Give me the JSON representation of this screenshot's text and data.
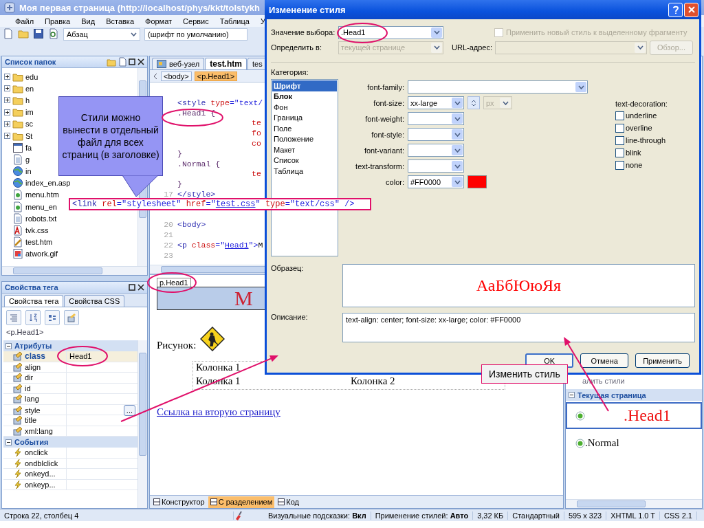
{
  "window": {
    "title": "Моя первая страница (http://localhost/phys/kkt/tolstykh"
  },
  "menu": [
    "Файл",
    "Правка",
    "Вид",
    "Вставка",
    "Формат",
    "Сервис",
    "Таблица",
    "У"
  ],
  "toolbar": {
    "block_format": "Абзац",
    "font": "(шрифт по умолчанию)"
  },
  "folders": {
    "title": "Список папок",
    "items": [
      {
        "name": "edu",
        "kind": "folder"
      },
      {
        "name": "en",
        "kind": "folder"
      },
      {
        "name": "h",
        "kind": "folder"
      },
      {
        "name": "im",
        "kind": "folder"
      },
      {
        "name": "sc",
        "kind": "folder"
      },
      {
        "name": "St",
        "kind": "folder"
      },
      {
        "name": "fa",
        "kind": "window"
      },
      {
        "name": "g",
        "kind": "page"
      },
      {
        "name": "in",
        "kind": "web"
      },
      {
        "name": "index_en.asp",
        "kind": "web"
      },
      {
        "name": "menu.htm",
        "kind": "html"
      },
      {
        "name": "menu_en",
        "kind": "html"
      },
      {
        "name": "robots.txt",
        "kind": "page"
      },
      {
        "name": "tvk.css",
        "kind": "css"
      },
      {
        "name": "test.htm",
        "kind": "edit"
      },
      {
        "name": "atwork.gif",
        "kind": "image"
      }
    ]
  },
  "tag_properties": {
    "title": "Свойства тега",
    "tabs": [
      {
        "label": "Свойства тега",
        "selected": true
      },
      {
        "label": "Свойства CSS",
        "selected": false
      }
    ],
    "path": "<p.Head1>",
    "groups": [
      {
        "title": "Атрибуты",
        "kind": "attribute",
        "rows": [
          {
            "name": "class",
            "value": "Head1",
            "selected": true
          },
          {
            "name": "align",
            "selected": false
          },
          {
            "name": "dir",
            "selected": false
          },
          {
            "name": "id",
            "selected": false
          },
          {
            "name": "lang",
            "selected": false
          },
          {
            "name": "style",
            "selected": false,
            "button": "..."
          },
          {
            "name": "title",
            "selected": false
          },
          {
            "name": "xml:lang",
            "selected": false
          }
        ]
      },
      {
        "title": "События",
        "kind": "event",
        "rows": [
          {
            "name": "onclick",
            "selected": false
          },
          {
            "name": "ondblclick",
            "selected": false
          },
          {
            "name": "onkeyd...",
            "selected": false
          },
          {
            "name": "onkeyp...",
            "selected": false
          }
        ]
      }
    ]
  },
  "editor": {
    "tabs": [
      {
        "label": "веб-узел",
        "selected": false
      },
      {
        "label": "test.htm",
        "selected": true
      },
      {
        "label": "tes",
        "selected": false
      }
    ],
    "breadcrumbs": [
      {
        "label": "<body>",
        "selected": false
      },
      {
        "label": "<p.Head1>",
        "selected": true
      }
    ],
    "code": [
      {
        "tokens": [
          {
            "text": "<style ",
            "kind": "tag"
          },
          {
            "text": "type",
            "kind": "attr"
          },
          {
            "text": "=\"text/",
            "kind": "value"
          }
        ]
      },
      {
        "tokens": [
          {
            "text": ".Head1 {",
            "kind": "selector"
          }
        ]
      },
      {
        "indent": true,
        "tokens": [
          {
            "text": "te",
            "kind": "prop"
          }
        ]
      },
      {
        "indent": true,
        "tokens": [
          {
            "text": "fo",
            "kind": "prop"
          }
        ]
      },
      {
        "indent": true,
        "tokens": [
          {
            "text": "co",
            "kind": "prop"
          }
        ]
      },
      {
        "tokens": [
          {
            "text": "}",
            "kind": "selector"
          }
        ]
      },
      {
        "tokens": [
          {
            "text": ".Normal {",
            "kind": "selector"
          }
        ]
      },
      {
        "indent": true,
        "tokens": [
          {
            "text": "te",
            "kind": "prop"
          }
        ]
      },
      {
        "tokens": [
          {
            "text": "}",
            "kind": "selector"
          }
        ]
      },
      {
        "number": "17",
        "tokens": [
          {
            "text": "</style>",
            "kind": "tag"
          }
        ]
      },
      {
        "number": "20",
        "tokens": [
          {
            "text": "<body>",
            "kind": "tag"
          }
        ]
      },
      {
        "number": "21"
      },
      {
        "number": "22",
        "tokens": [
          {
            "text": "<p ",
            "kind": "tag"
          },
          {
            "text": "class",
            "kind": "attr"
          },
          {
            "text": "=\"",
            "kind": "value"
          },
          {
            "text": "Head1",
            "kind": "link"
          },
          {
            "text": "\">",
            "kind": "value"
          },
          {
            "text": "M",
            "kind": "plain"
          }
        ]
      },
      {
        "number": "23"
      }
    ],
    "design": {
      "tag_label": "p.Head1",
      "heading": "М",
      "figure_label": "Рисунок:",
      "table": [
        [
          "Колонка 1"
        ],
        [
          "Колонка 1",
          "Колонка 2"
        ]
      ],
      "link": "Ссылка на вторую страницу"
    },
    "views": [
      {
        "label": "Конструктор",
        "selected": false
      },
      {
        "label": "С разделением",
        "selected": true
      },
      {
        "label": "Код",
        "selected": false
      }
    ]
  },
  "styles_panel": {
    "action": "алить стили",
    "section": "Текущая страница",
    "items": [
      {
        "name": ".Head1",
        "selected": true,
        "kind": "heading"
      },
      {
        "name": ".Normal",
        "selected": false,
        "kind": "normal"
      }
    ]
  },
  "status_bar": {
    "position": "Строка 22, столбец 4",
    "items": [
      {
        "label": "Визуальные подсказки:",
        "value": "Вкл"
      },
      {
        "label": "Применение стилей:",
        "value": "Авто"
      },
      {
        "label": "3,32 КБ"
      },
      {
        "label": "Стандартный"
      },
      {
        "label": "595 x 323"
      },
      {
        "label": "XHTML 1.0 T"
      },
      {
        "label": "CSS 2.1"
      }
    ]
  },
  "dialog": {
    "title": "Изменение стиля",
    "selector": {
      "label": "Значение выбора:",
      "value": ".Head1"
    },
    "apply_new": {
      "label": "Применить новый стиль к выделенному фрагменту",
      "checked": false,
      "disabled": true
    },
    "define_in": {
      "label": "Определить в:",
      "value": "текущей странице",
      "disabled": true
    },
    "url": {
      "label": "URL-адрес:",
      "disabled": true
    },
    "browse": {
      "label": "Обзор...",
      "disabled": true
    },
    "category_label": "Категория:",
    "categories": [
      {
        "label": "Шрифт",
        "selected": true,
        "modified": true
      },
      {
        "label": "Блок",
        "selected": false,
        "modified": true
      },
      {
        "label": "Фон",
        "selected": false,
        "modified": false
      },
      {
        "label": "Граница",
        "selected": false,
        "modified": false
      },
      {
        "label": "Поле",
        "selected": false,
        "modified": false
      },
      {
        "label": "Положение",
        "selected": false,
        "modified": false
      },
      {
        "label": "Макет",
        "selected": false,
        "modified": false
      },
      {
        "label": "Список",
        "selected": false,
        "modified": false
      },
      {
        "label": "Таблица",
        "selected": false,
        "modified": false
      }
    ],
    "fields": [
      {
        "label": "font-family:",
        "kind": "wide"
      },
      {
        "label": "font-size:",
        "kind": "size",
        "value": "xx-large",
        "unit": "px"
      },
      {
        "label": "font-weight:",
        "kind": "select"
      },
      {
        "label": "font-style:",
        "kind": "select"
      },
      {
        "label": "font-variant:",
        "kind": "select"
      },
      {
        "label": "text-transform:",
        "kind": "select"
      },
      {
        "label": "color:",
        "kind": "color",
        "value": "#FF0000"
      }
    ],
    "decoration": {
      "label": "text-decoration:",
      "options": [
        {
          "label": "underline",
          "checked": false
        },
        {
          "label": "overline",
          "checked": false
        },
        {
          "label": "line-through",
          "checked": false
        },
        {
          "label": "blink",
          "checked": false
        },
        {
          "label": "none",
          "checked": false
        }
      ]
    },
    "preview": {
      "label": "Образец:",
      "text": "АаБбЮюЯя"
    },
    "description": {
      "label": "Описание:",
      "text": "text-align: center; font-size: xx-large; color: #FF0000"
    },
    "buttons": [
      {
        "label": "OK",
        "default": true
      },
      {
        "label": "Отмена",
        "default": false
      },
      {
        "label": "Применить",
        "default": false
      }
    ]
  },
  "annotations": {
    "callouts": [
      {
        "text": "Стили можно вынести в отдельный файл для всех страниц (в заголовке)",
        "kind": "bubble"
      },
      {
        "text": "Изменить стиль",
        "kind": "label"
      }
    ],
    "link_line": [
      {
        "text": "<link ",
        "kind": "tag"
      },
      {
        "text": "rel",
        "kind": "attr"
      },
      {
        "text": "=\"stylesheet\" ",
        "kind": "value"
      },
      {
        "text": "href",
        "kind": "attr"
      },
      {
        "text": "=\"",
        "kind": "value"
      },
      {
        "text": "test.css",
        "kind": "link"
      },
      {
        "text": "\" ",
        "kind": "value"
      },
      {
        "text": "type",
        "kind": "attr"
      },
      {
        "text": "=\"text/css\" />",
        "kind": "value"
      }
    ]
  }
}
